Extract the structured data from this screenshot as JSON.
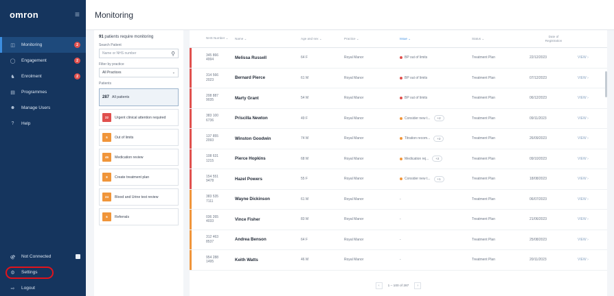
{
  "sidebar": {
    "brand": "omron",
    "menu_icon": "menu-icon",
    "items": [
      {
        "label": "Monitoring",
        "icon": "monitor-icon",
        "badge": "2",
        "active": true
      },
      {
        "label": "Engagement",
        "icon": "chat-icon",
        "badge": "2"
      },
      {
        "label": "Enrolment",
        "icon": "user-add-icon",
        "badge": "2"
      },
      {
        "label": "Programmes",
        "icon": "clipboard-icon"
      },
      {
        "label": "Manage Users",
        "icon": "users-icon"
      },
      {
        "label": "Help",
        "icon": "help-icon"
      }
    ],
    "bottom": [
      {
        "label": "Not Connected",
        "icon": "plug-icon"
      },
      {
        "label": "Settings",
        "icon": "gear-icon"
      },
      {
        "label": "Logout",
        "icon": "logout-icon"
      }
    ]
  },
  "page": {
    "title": "Monitoring"
  },
  "filters": {
    "count_number": "91",
    "count_text": "patients require monitoring",
    "search_label": "Search Patient",
    "search_placeholder": "Name or NHS number",
    "practice_label": "Filter by practice",
    "practice_value": "All Practices",
    "patients_label": "Patients",
    "cards": [
      {
        "count": "287",
        "label": "All patients",
        "selected": true
      },
      {
        "count": "22",
        "label": "Urgent clinical attention required",
        "color": "#e0504d"
      },
      {
        "count": "6",
        "label": "Out of limits",
        "color": "#f0953a"
      },
      {
        "count": "46",
        "label": "Medication review",
        "color": "#f0953a"
      },
      {
        "count": "8",
        "label": "Create treatment plan",
        "color": "#f0953a"
      },
      {
        "count": "24",
        "label": "Blood and Urine test review",
        "color": "#f0953a"
      },
      {
        "count": "6",
        "label": "Referrals",
        "color": "#f0953a"
      }
    ]
  },
  "table": {
    "headers": {
      "nhs": "NHS Number",
      "name": "Name",
      "age": "Age and sex",
      "practice": "Practice",
      "issue": "Issue",
      "status": "Status",
      "date_line1": "Date of",
      "date_line2": "Registration"
    },
    "rows": [
      {
        "nhs1": "345 866",
        "nhs2": "4994",
        "name": "Melissa Russell",
        "age": "64  F",
        "practice": "Royal Manor",
        "issue": "BP out of limits",
        "issue_color": "#e0504d",
        "status": "Treatment Plan",
        "date": "22/12/2023",
        "bar": "#e0504d",
        "view": "VIEW"
      },
      {
        "nhs1": "314 566",
        "nhs2": "2023",
        "name": "Bernard Pierce",
        "age": "61  M",
        "practice": "Royal Manor",
        "issue": "BP out of limits",
        "issue_color": "#e0504d",
        "status": "Treatment Plan",
        "date": "07/12/2023",
        "bar": "#e0504d",
        "view": "VIEW"
      },
      {
        "nhs1": "208 887",
        "nhs2": "9035",
        "name": "Marty Grant",
        "age": "54  M",
        "practice": "Royal Manor",
        "issue": "BP out of limits",
        "issue_color": "#e0504d",
        "status": "Treatment Plan",
        "date": "06/12/2023",
        "bar": "#e0504d",
        "view": "VIEW"
      },
      {
        "nhs1": "383 100",
        "nhs2": "6736",
        "name": "Priscilla Newton",
        "age": "49  F",
        "practice": "Royal Manor",
        "issue": "Consider new t...",
        "issue_color": "#f0953a",
        "more": "+2",
        "status": "Treatment Plan",
        "date": "09/11/2023",
        "bar": "#e0504d",
        "view": "VIEW"
      },
      {
        "nhs1": "137 855",
        "nhs2": "2093",
        "name": "Winston Goodwin",
        "age": "74  M",
        "practice": "Royal Manor",
        "issue": "Titration recom...",
        "issue_color": "#f0953a",
        "more": "+2",
        "status": "Treatment Plan",
        "date": "26/09/2023",
        "bar": "#e0504d",
        "view": "VIEW"
      },
      {
        "nhs1": "108 631",
        "nhs2": "1215",
        "name": "Pierce Hopkins",
        "age": "68  M",
        "practice": "Royal Manor",
        "issue": "Medication rej...",
        "issue_color": "#f0953a",
        "more": "+2",
        "status": "Treatment Plan",
        "date": "09/10/2023",
        "bar": "#e0504d",
        "view": "VIEW"
      },
      {
        "nhs1": "154 551",
        "nhs2": "9478",
        "name": "Hazel Powers",
        "age": "55  F",
        "practice": "Royal Manor",
        "issue": "Consider new t...",
        "issue_color": "#f0953a",
        "more": "+1",
        "status": "Treatment Plan",
        "date": "18/08/2023",
        "bar": "#e0504d",
        "view": "VIEW"
      },
      {
        "nhs1": "383 535",
        "nhs2": "7111",
        "name": "Wayne Dickinson",
        "age": "61  M",
        "practice": "Royal Manor",
        "issue": "-",
        "status": "Treatment Plan",
        "date": "06/07/2023",
        "bar": "#f0953a",
        "view": "VIEW"
      },
      {
        "nhs1": "036 265",
        "nhs2": "4033",
        "name": "Vince Fisher",
        "age": "83  M",
        "practice": "Royal Manor",
        "issue": "-",
        "status": "Treatment Plan",
        "date": "21/06/2023",
        "bar": "#f0953a",
        "view": "VIEW"
      },
      {
        "nhs1": "312 463",
        "nhs2": "8537",
        "name": "Andrea Benson",
        "age": "64  F",
        "practice": "Royal Manor",
        "issue": "-",
        "status": "Treatment Plan",
        "date": "25/08/2023",
        "bar": "#f0953a",
        "view": "VIEW"
      },
      {
        "nhs1": "954 288",
        "nhs2": "1495",
        "name": "Keith Watts",
        "age": "46  M",
        "practice": "Royal Manor",
        "issue": "-",
        "status": "Treatment Plan",
        "date": "20/11/2023",
        "bar": "#f0953a",
        "view": "VIEW"
      }
    ],
    "pagination": "1 – 100 of 287"
  }
}
